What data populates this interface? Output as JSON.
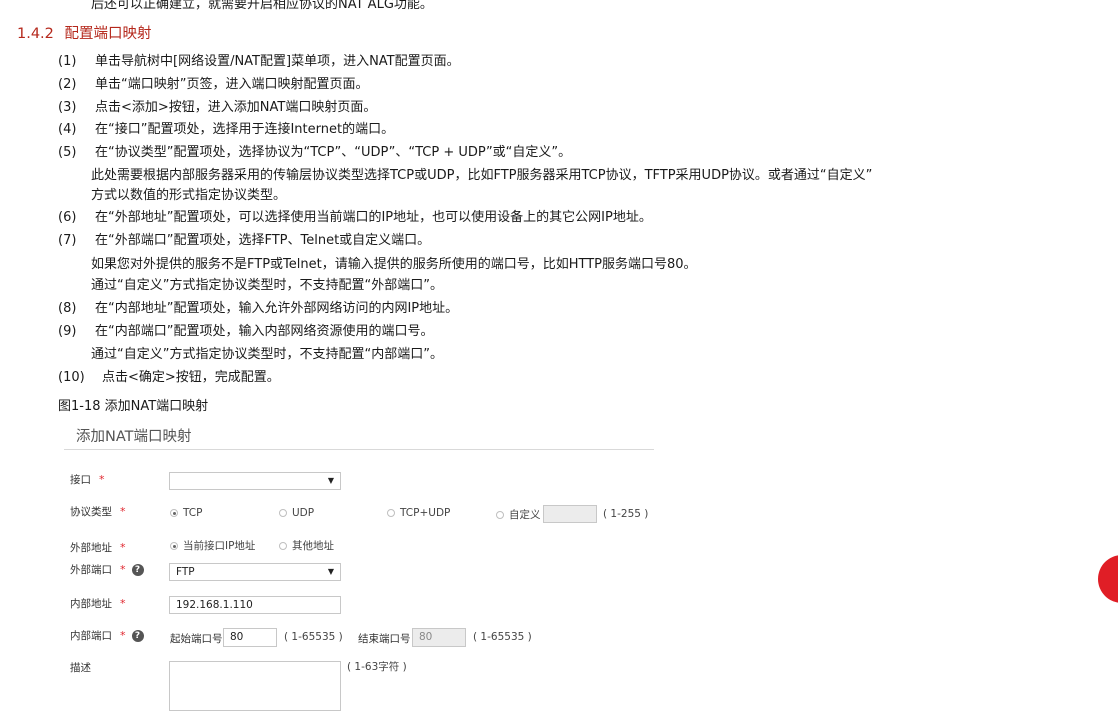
{
  "intro_line": "后还可以正确建立，就需要开启相应协议的NAT ALG功能。",
  "section": {
    "number": "1.4.2",
    "title": "配置端口映射"
  },
  "steps": [
    {
      "num": "(1)",
      "text": "单击导航树中[网络设置/NAT配置]菜单项，进入NAT配置页面。"
    },
    {
      "num": "(2)",
      "text": "单击“端口映射”页签，进入端口映射配置页面。"
    },
    {
      "num": "(3)",
      "text": "点击<添加>按钮，进入添加NAT端口映射页面。"
    },
    {
      "num": "(4)",
      "text": "在“接口”配置项处，选择用于连接Internet的端口。"
    },
    {
      "num": "(5)",
      "text": "在“协议类型”配置项处，选择协议为“TCP”、“UDP”、“TCP + UDP”或“自定义”。",
      "notes": [
        "此处需要根据内部服务器采用的传输层协议类型选择TCP或UDP，比如FTP服务器采用TCP协议，TFTP采用UDP协议。或者通过“自定义”",
        "方式以数值的形式指定协议类型。"
      ]
    },
    {
      "num": "(6)",
      "text": "在“外部地址”配置项处，可以选择使用当前端口的IP地址，也可以使用设备上的其它公网IP地址。"
    },
    {
      "num": "(7)",
      "text": "在“外部端口”配置项处，选择FTP、Telnet或自定义端口。",
      "notes": [
        "如果您对外提供的服务不是FTP或Telnet，请输入提供的服务所使用的端口号，比如HTTP服务端口号80。",
        "通过“自定义”方式指定协议类型时，不支持配置“外部端口”。"
      ]
    },
    {
      "num": "(8)",
      "text": "在“内部地址”配置项处，输入允许外部网络访问的内网IP地址。"
    },
    {
      "num": "(9)",
      "text": "在“内部端口”配置项处，输入内部网络资源使用的端口号。",
      "notes": [
        "通过“自定义”方式指定协议类型时，不支持配置“内部端口”。"
      ]
    },
    {
      "num": "(10)",
      "text": "点击<确定>按钮，完成配置。"
    }
  ],
  "figure_caption": "图1-18 添加NAT端口映射",
  "form": {
    "title": "添加NAT端口映射",
    "required_mark": "*",
    "interface": {
      "label": "接口",
      "value": ""
    },
    "protocol": {
      "label": "协议类型",
      "options": [
        "TCP",
        "UDP",
        "TCP+UDP",
        "自定义"
      ],
      "selected": "TCP",
      "custom_value": "",
      "custom_range": "( 1-255 )"
    },
    "external_address": {
      "label": "外部地址",
      "options": [
        "当前接口IP地址",
        "其他地址"
      ],
      "selected": "当前接口IP地址"
    },
    "external_port": {
      "label": "外部端口",
      "value": "FTP"
    },
    "internal_address": {
      "label": "内部地址",
      "value": "192.168.1.110"
    },
    "internal_port": {
      "label": "内部端口",
      "start_label": "起始端口号",
      "start_value": "80",
      "start_range": "( 1-65535 )",
      "end_label": "结束端口号",
      "end_value": "80",
      "end_range": "( 1-65535 )"
    },
    "description": {
      "label": "描述",
      "value": "",
      "hint": "( 1-63字符 )"
    },
    "help_glyph": "?",
    "dropdown_glyph": "▼"
  }
}
